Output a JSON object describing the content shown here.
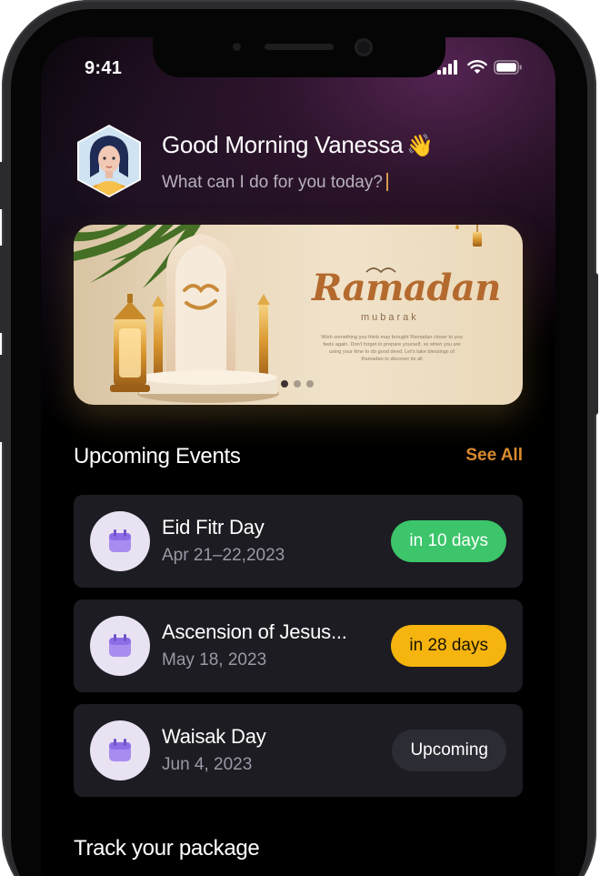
{
  "status_bar": {
    "time": "9:41"
  },
  "greeting": {
    "title": "Good Morning Vanessa",
    "wave_emoji": "👋",
    "subtitle": "What can I do for you today?"
  },
  "banner": {
    "title": "Ramadan",
    "subtitle": "mubarak",
    "body": "Wish something you think may brought Ramadan closer to you feels again. Don't forget to prepare yourself, so when you are using your time to do good deed. Let's take blessings of Ramadan to discover its all",
    "slide_count": 3,
    "active_slide": 1
  },
  "events": {
    "section_title": "Upcoming Events",
    "see_all_label": "See All",
    "items": [
      {
        "name": "Eid Fitr Day",
        "date": "Apr 21–22,2023",
        "badge": "in 10 days",
        "badge_color": "#3cc56a"
      },
      {
        "name": "Ascension of Jesus...",
        "date": "May 18, 2023",
        "badge": "in 28 days",
        "badge_color": "#f6b40e"
      },
      {
        "name": "Waisak Day",
        "date": "Jun 4, 2023",
        "badge": "Upcoming",
        "badge_color": "#2c2c34"
      }
    ]
  },
  "track": {
    "section_title": "Track your package"
  },
  "colors": {
    "accent_orange": "#d98a2e",
    "card_bg": "#1c1c22",
    "calendar_icon": "#a98cf0"
  },
  "icons": [
    "signal-icon",
    "wifi-icon",
    "battery-icon",
    "calendar-icon"
  ]
}
